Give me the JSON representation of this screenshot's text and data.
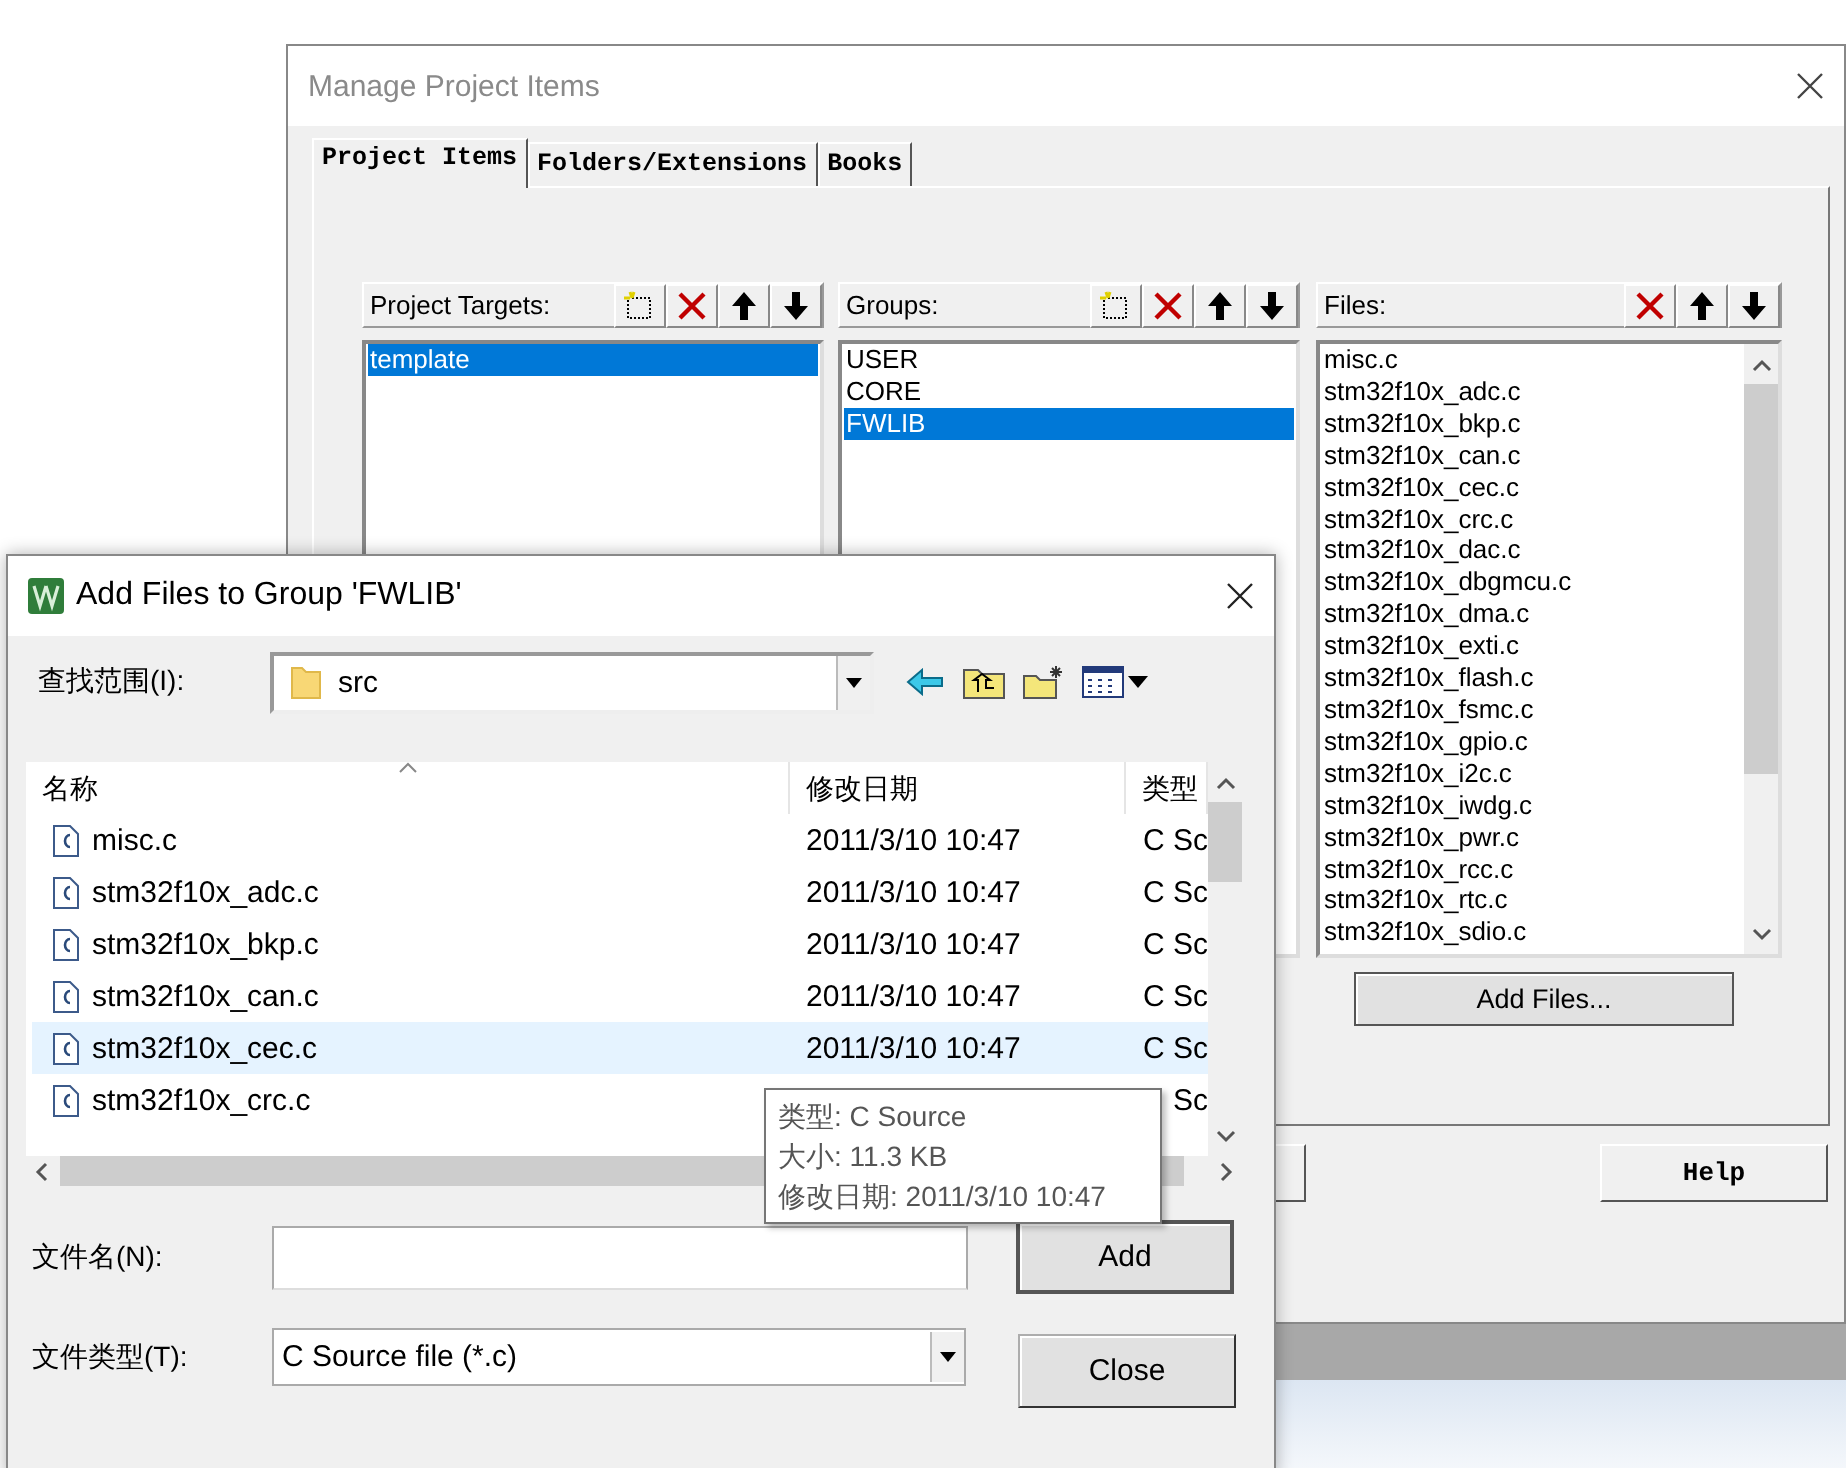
{
  "manage_window": {
    "title": "Manage Project Items",
    "tabs": [
      {
        "label": "Project Items",
        "selected": true
      },
      {
        "label": "Folders/Extensions",
        "selected": false
      },
      {
        "label": "Books",
        "selected": false
      }
    ],
    "panels": [
      {
        "label": "Project Targets:",
        "tools": [
          {
            "kind": "new"
          },
          {
            "kind": "delete"
          },
          {
            "kind": "up"
          },
          {
            "kind": "down"
          }
        ],
        "items": [
          {
            "text": "template",
            "selected": true
          }
        ]
      },
      {
        "label": "Groups:",
        "tools": [
          {
            "kind": "new"
          },
          {
            "kind": "delete"
          },
          {
            "kind": "up"
          },
          {
            "kind": "down"
          }
        ],
        "items": [
          {
            "text": "USER",
            "selected": false
          },
          {
            "text": "CORE",
            "selected": false
          },
          {
            "text": "FWLIB",
            "selected": true
          }
        ]
      },
      {
        "label": "Files:",
        "tools": [
          {
            "kind": "delete"
          },
          {
            "kind": "up"
          },
          {
            "kind": "down"
          }
        ],
        "items": [
          {
            "text": "misc.c",
            "selected": false
          },
          {
            "text": "stm32f10x_adc.c",
            "selected": false
          },
          {
            "text": "stm32f10x_bkp.c",
            "selected": false
          },
          {
            "text": "stm32f10x_can.c",
            "selected": false
          },
          {
            "text": "stm32f10x_cec.c",
            "selected": false
          },
          {
            "text": "stm32f10x_crc.c",
            "selected": false
          },
          {
            "text": "stm32f10x_dac.c",
            "selected": false
          },
          {
            "text": "stm32f10x_dbgmcu.c",
            "selected": false
          },
          {
            "text": "stm32f10x_dma.c",
            "selected": false
          },
          {
            "text": "stm32f10x_exti.c",
            "selected": false
          },
          {
            "text": "stm32f10x_flash.c",
            "selected": false
          },
          {
            "text": "stm32f10x_fsmc.c",
            "selected": false
          },
          {
            "text": "stm32f10x_gpio.c",
            "selected": false
          },
          {
            "text": "stm32f10x_i2c.c",
            "selected": false
          },
          {
            "text": "stm32f10x_iwdg.c",
            "selected": false
          },
          {
            "text": "stm32f10x_pwr.c",
            "selected": false
          },
          {
            "text": "stm32f10x_rcc.c",
            "selected": false
          },
          {
            "text": "stm32f10x_rtc.c",
            "selected": false
          },
          {
            "text": "stm32f10x_sdio.c",
            "selected": false
          }
        ],
        "button": "Add Files..."
      }
    ],
    "help_button": "Help"
  },
  "dialog": {
    "title": "Add Files to Group 'FWLIB'",
    "look_in": {
      "label": "查找范围(I):",
      "value": "src"
    },
    "columns": [
      "名称",
      "修改日期",
      "类型"
    ],
    "rows": [
      {
        "name": "misc.c",
        "date": "2011/3/10 10:47",
        "type": "C Sc",
        "selected": false
      },
      {
        "name": "stm32f10x_adc.c",
        "date": "2011/3/10 10:47",
        "type": "C Sc",
        "selected": false
      },
      {
        "name": "stm32f10x_bkp.c",
        "date": "2011/3/10 10:47",
        "type": "C Sc",
        "selected": false
      },
      {
        "name": "stm32f10x_can.c",
        "date": "2011/3/10 10:47",
        "type": "C Sc",
        "selected": false
      },
      {
        "name": "stm32f10x_cec.c",
        "date": "2011/3/10 10:47",
        "type": "C Sc",
        "selected": true
      },
      {
        "name": "stm32f10x_crc.c",
        "type": "Sc",
        "selected": false
      }
    ],
    "tooltip": [
      "类型: C Source",
      "大小: 11.3 KB",
      "修改日期: 2011/3/10 10:47"
    ],
    "file_name": {
      "label": "文件名(N):"
    },
    "file_type": {
      "label": "文件类型(T):",
      "value": "C Source file (*.c)"
    },
    "buttons": [
      "Add",
      "Close"
    ]
  }
}
